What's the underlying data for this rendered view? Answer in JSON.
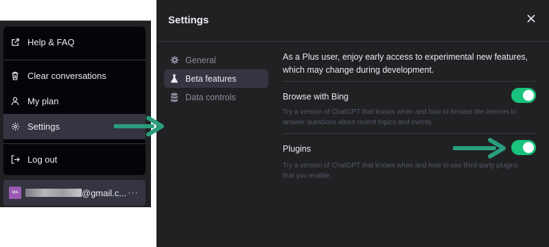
{
  "menu": {
    "items": [
      {
        "label": "Help & FAQ",
        "icon": "external-link-icon"
      },
      {
        "label": "Clear conversations",
        "icon": "trash-icon"
      },
      {
        "label": "My plan",
        "icon": "user-icon"
      },
      {
        "label": "Settings",
        "icon": "gear-icon"
      },
      {
        "label": "Log out",
        "icon": "logout-icon"
      }
    ],
    "user": {
      "avatar_initials": "MA",
      "email_suffix": "@gmail.c...",
      "more": "···"
    }
  },
  "settings": {
    "title": "Settings",
    "nav": [
      {
        "label": "General",
        "icon": "gear-icon"
      },
      {
        "label": "Beta features",
        "icon": "flask-icon"
      },
      {
        "label": "Data controls",
        "icon": "database-icon"
      }
    ],
    "intro": "As a Plus user, enjoy early access to experimental new features, which may change during development.",
    "features": [
      {
        "title": "Browse with Bing",
        "description": "Try a version of ChatGPT that knows when and how to browse the internet to answer questions about recent topics and events.",
        "enabled": true
      },
      {
        "title": "Plugins",
        "description": "Try a version of ChatGPT that knows when and how to use third-party plugins that you enable.",
        "enabled": true
      }
    ]
  },
  "colors": {
    "accent": "#19c37d",
    "arrow": "#2a9d7e",
    "dialog_bg": "#202123"
  }
}
